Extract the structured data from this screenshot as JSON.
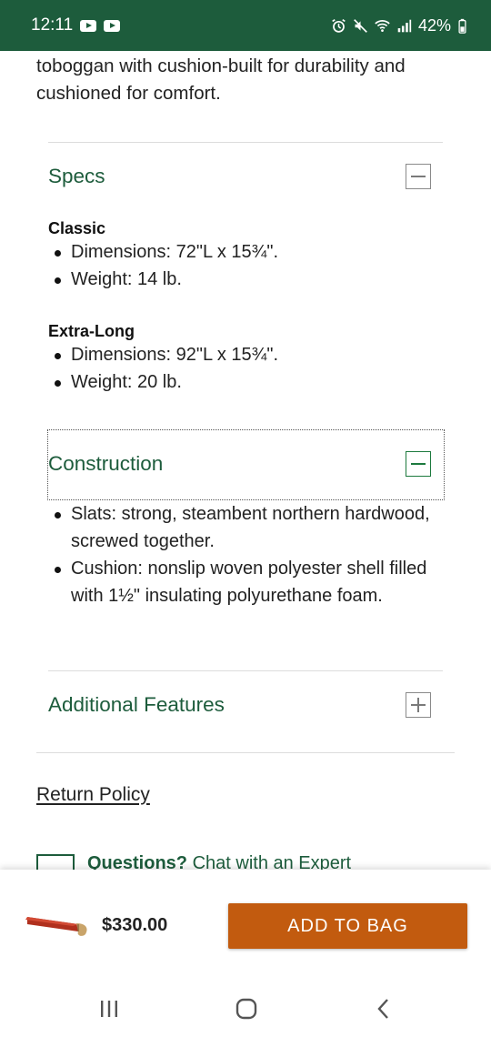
{
  "status_bar": {
    "time": "12:11",
    "battery": "42%",
    "left_icons": [
      "youtube-icon",
      "youtube-icon"
    ],
    "right_icons": [
      "alarm-icon",
      "mute-icon",
      "wifi-icon",
      "signal-icon",
      "battery-icon"
    ]
  },
  "intro_text": "toboggan with cushion-built for durability and cushioned for comfort.",
  "specs": {
    "title": "Specs",
    "expanded": true,
    "groups": [
      {
        "name": "Classic",
        "items": [
          "Dimensions: 72\"L x 15¾\".",
          "Weight: 14 lb."
        ]
      },
      {
        "name": "Extra-Long",
        "items": [
          "Dimensions: 92\"L x 15¾\".",
          "Weight: 20 lb."
        ]
      }
    ]
  },
  "construction": {
    "title": "Construction",
    "expanded": true,
    "items": [
      "Slats: strong, steambent northern hardwood, screwed together.",
      "Cushion: nonslip woven polyester shell filled with 1½\" insulating polyurethane foam."
    ]
  },
  "additional_features": {
    "title": "Additional Features",
    "expanded": false
  },
  "return_policy": "Return Policy",
  "questions": {
    "bold": "Questions?",
    "link": "Chat with an Expert"
  },
  "purchase_bar": {
    "price": "$330.00",
    "add_button": "ADD TO BAG",
    "product_color": "#b0301e"
  },
  "colors": {
    "brand_green": "#1d5c3c",
    "cta_orange": "#c25b0f"
  },
  "nav_bar": [
    "recents-icon",
    "home-icon",
    "back-icon"
  ]
}
